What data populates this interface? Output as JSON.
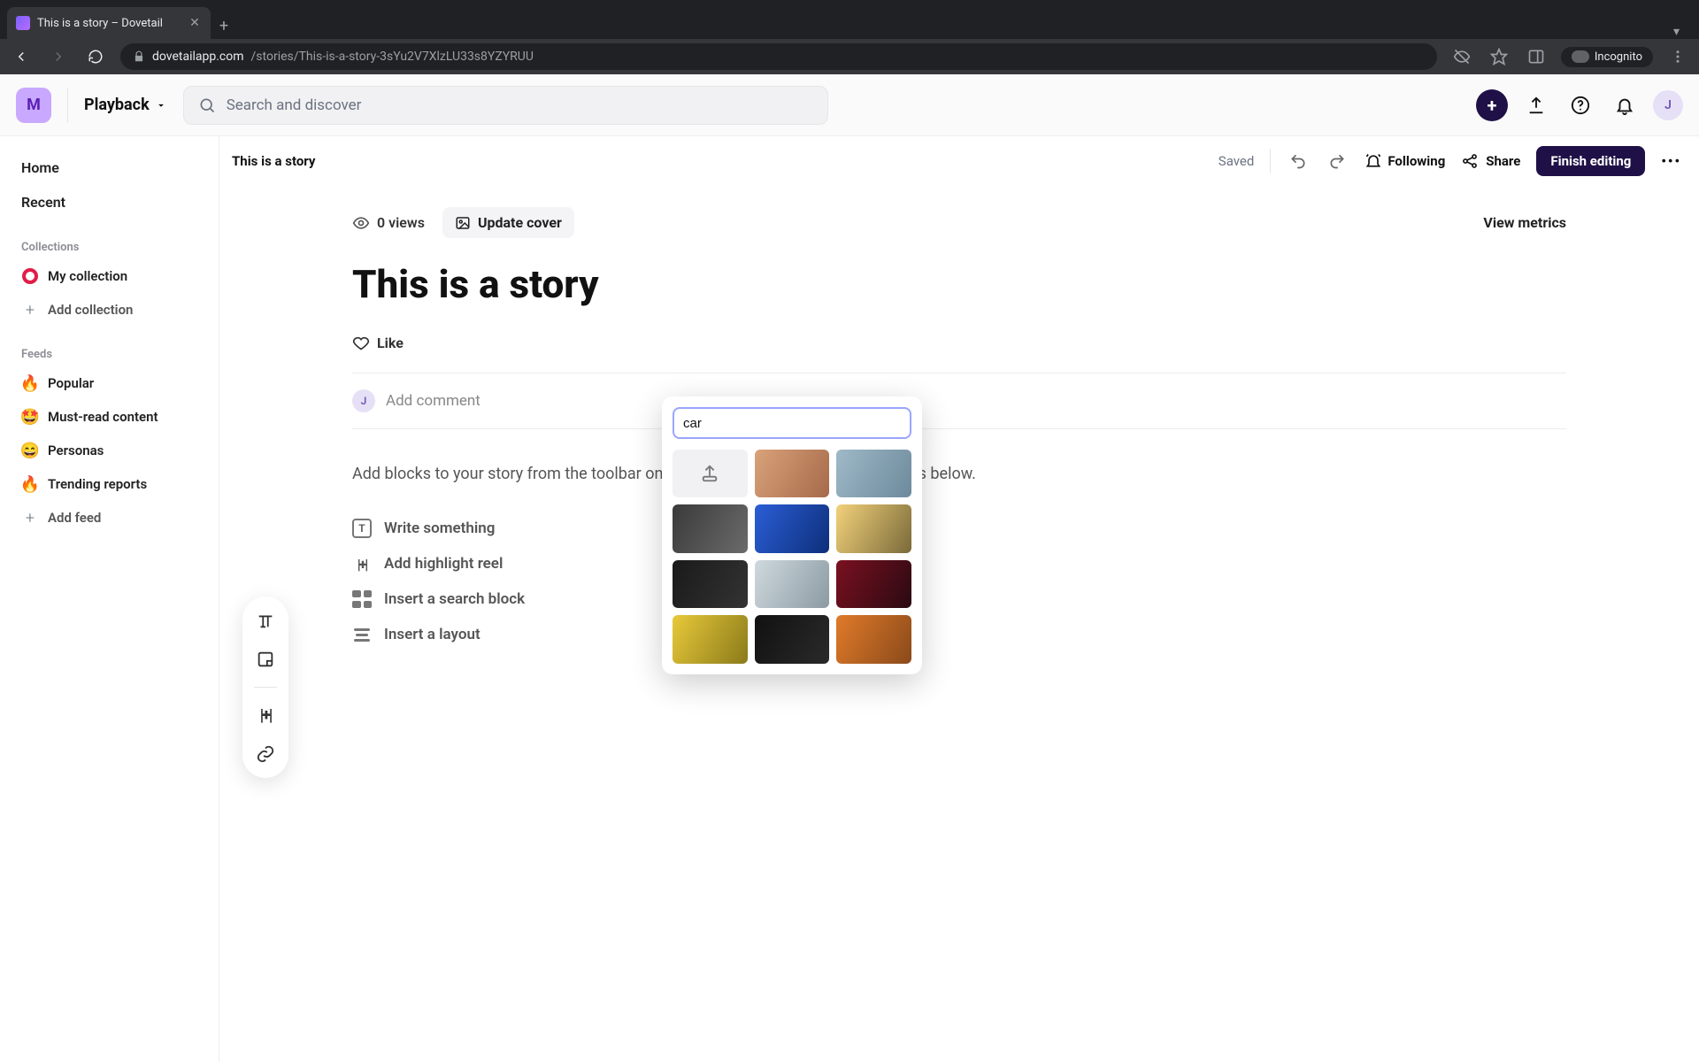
{
  "browser": {
    "tab_title": "This is a story – Dovetail",
    "url_host": "dovetailapp.com",
    "url_path": "/stories/This-is-a-story-3sYu2V7XlzLU33s8YZYRUU",
    "incognito_label": "Incognito"
  },
  "top": {
    "workspace_initial": "M",
    "playback_label": "Playback",
    "search_placeholder": "Search and discover",
    "avatar_initial": "J"
  },
  "sidebar": {
    "home": "Home",
    "recent": "Recent",
    "collections_header": "Collections",
    "my_collection": "My collection",
    "add_collection": "Add collection",
    "feeds_header": "Feeds",
    "feeds": [
      {
        "emoji": "🔥",
        "label": "Popular"
      },
      {
        "emoji": "🤩",
        "label": "Must-read content"
      },
      {
        "emoji": "😄",
        "label": "Personas"
      },
      {
        "emoji": "🔥",
        "label": "Trending reports"
      }
    ],
    "add_feed": "Add feed"
  },
  "doc": {
    "breadcrumb_title": "This is a story",
    "saved_label": "Saved",
    "following_label": "Following",
    "share_label": "Share",
    "finish_label": "Finish editing",
    "views_label": "0 views",
    "update_cover_label": "Update cover",
    "view_metrics_label": "View metrics",
    "page_title": "This is a story",
    "like_label": "Like",
    "comment_placeholder": "Add comment",
    "blocks_hint": "Add blocks to your story from the toolbar on the left, or choose one of the options below.",
    "block_options": {
      "write": "Write something",
      "highlight": "Add highlight reel",
      "search": "Insert a search block",
      "layout": "Insert a layout"
    }
  },
  "cover_popover": {
    "search_value": "car",
    "thumbs": [
      {
        "name": "upload"
      },
      {
        "name": "suv-desert",
        "bg": "linear-gradient(120deg,#d9a27a,#a66a4a)"
      },
      {
        "name": "sedan-highway",
        "bg": "linear-gradient(120deg,#9fb9c7,#6c8a9c)"
      },
      {
        "name": "mustang-bw",
        "bg": "linear-gradient(120deg,#3a3a3a,#6b6b6b)"
      },
      {
        "name": "blue-sports",
        "bg": "linear-gradient(120deg,#2b5ed6,#0d2f7a)"
      },
      {
        "name": "sunset-car",
        "bg": "linear-gradient(120deg,#f2d17a,#7a6a3a)"
      },
      {
        "name": "supercar-dark",
        "bg": "linear-gradient(120deg,#1a1a1a,#333)"
      },
      {
        "name": "headlight-closeup",
        "bg": "linear-gradient(120deg,#cfd9de,#8b9aa3)"
      },
      {
        "name": "taillights-night",
        "bg": "linear-gradient(120deg,#7a1020,#2a0a12)"
      },
      {
        "name": "yellow-sports",
        "bg": "linear-gradient(120deg,#e8c93a,#8a7a1a)"
      },
      {
        "name": "garage-dark",
        "bg": "linear-gradient(120deg,#111,#2a2a2a)"
      },
      {
        "name": "orange-beetle",
        "bg": "linear-gradient(120deg,#e07a2a,#8a4a1a)"
      }
    ]
  }
}
